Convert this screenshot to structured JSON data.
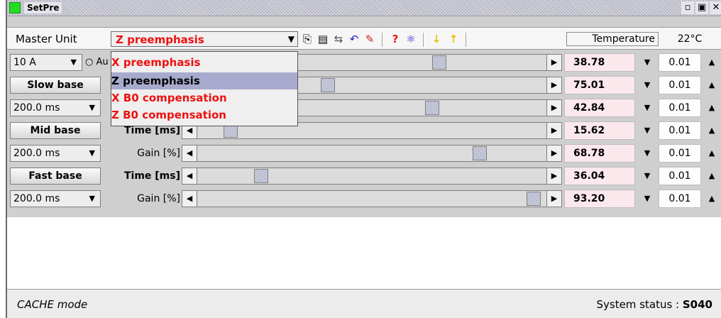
{
  "window": {
    "title": "SetPre",
    "buttons": [
      "▫",
      "▣",
      "✕"
    ]
  },
  "toolbar": {
    "master_label": "Master Unit",
    "combo_value": "Z preemphasis",
    "temperature_label": "Temperature",
    "temperature_value": "22°C",
    "icons": [
      "copy-icon",
      "paste-icon",
      "swap-icon",
      "undo-icon",
      "brush-icon",
      "help-icon",
      "atom-icon",
      "download-icon",
      "upload-icon"
    ]
  },
  "dropdown": {
    "options": [
      "X preemphasis",
      "Z preemphasis",
      "X B0 compensation",
      "Z B0 compensation"
    ],
    "selected": "Z preemphasis"
  },
  "rows": [
    {
      "left": "10 A",
      "radio": "Au",
      "label": "",
      "value": "38.78",
      "step": "0.01",
      "level": 0.7
    },
    {
      "left": "Slow base",
      "label": "",
      "value": "75.01",
      "step": "0.01",
      "level": 0.37
    },
    {
      "left": "200.0 ms",
      "label": "",
      "value": "42.84",
      "step": "0.01",
      "level": 0.68
    },
    {
      "left": "Mid base",
      "label": "Time [ms]",
      "value": "15.62",
      "step": "0.01",
      "level": 0.08
    },
    {
      "left": "200.0 ms",
      "label": "Gain [%]",
      "value": "68.78",
      "step": "0.01",
      "level": 0.82
    },
    {
      "left": "Fast base",
      "label": "Time [ms]",
      "value": "36.04",
      "step": "0.01",
      "level": 0.17
    },
    {
      "left": "200.0 ms",
      "label": "Gain [%]",
      "value": "93.20",
      "step": "0.01",
      "level": 0.98
    }
  ],
  "status": {
    "mode": "CACHE mode",
    "system_label": "System status : ",
    "system_code": "S040"
  }
}
